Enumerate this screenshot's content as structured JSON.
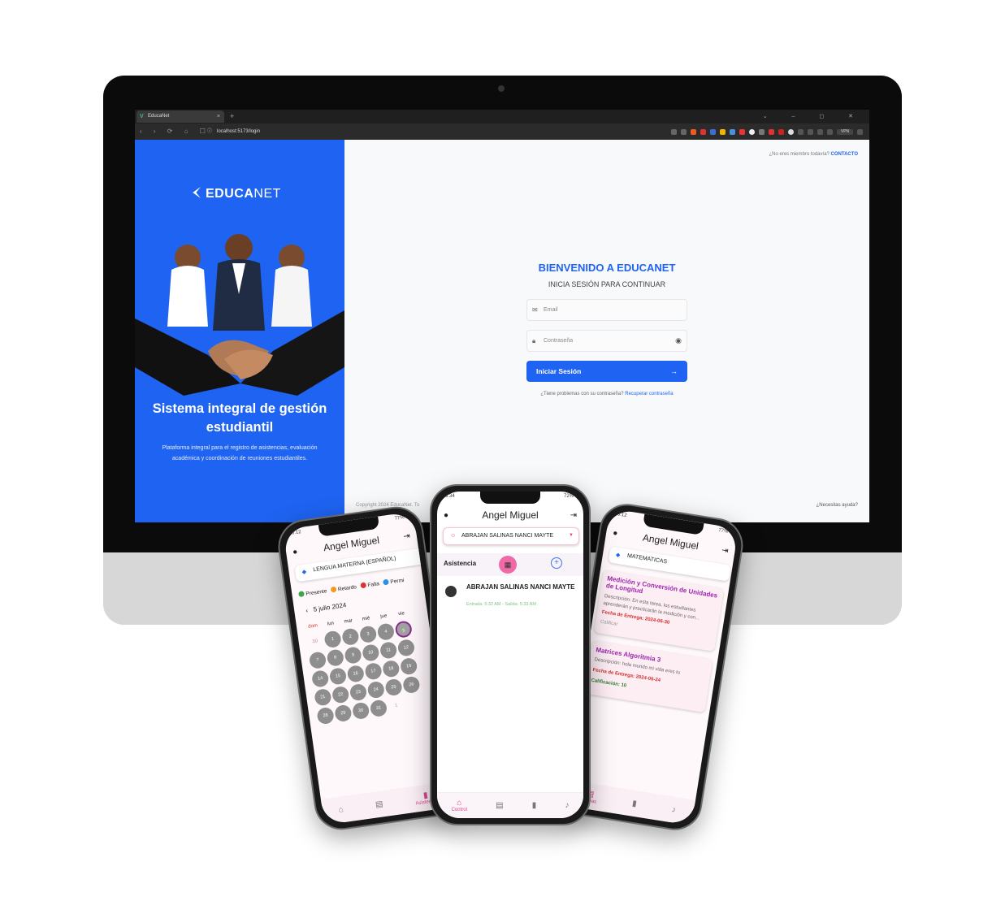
{
  "browser": {
    "tab_title": "EducaNet",
    "tab_close": "×",
    "new_tab": "+",
    "window_controls": "⌄ – ◻ ✕",
    "nav": "‹ › ⟳ ⌂ ☐",
    "url": "localhost:5173/login",
    "vpn": "VPN"
  },
  "hero": {
    "logo_bold": "EDUCA",
    "logo_light": "NET",
    "title": "Sistema integral de gestión estudiantil",
    "subtitle": "Plataforma integral para el registro de asistencias, evaluación académica y coordinación de reuniones estudiantiles."
  },
  "login": {
    "member_prompt": "¿No eres miembro todavía?",
    "member_link": "CONTACTO",
    "welcome": "BIENVENIDO A EDUCANET",
    "subtitle": "INICIA SESIÓN PARA CONTINUAR",
    "email_placeholder": "Email",
    "password_placeholder": "Contraseña",
    "submit": "Iniciar Sesión",
    "forgot_prompt": "¿Tiene problemas con su contraseña?",
    "forgot_link": "Recuperar contraseña",
    "copyright": "Copyright 2024 EducaNet. To",
    "help": "¿Necesitas ayuda?"
  },
  "phone_left": {
    "status": "6:12",
    "battery": "77%",
    "title": "Angel Miguel",
    "subject": "LENGUA MATERNA (ESPAÑOL)",
    "legend": [
      {
        "label": "Presente",
        "color": "#3aa646"
      },
      {
        "label": "Retardo",
        "color": "#f29a1d"
      },
      {
        "label": "Falta",
        "color": "#e03030"
      },
      {
        "label": "Permi",
        "color": "#2f8fe6"
      }
    ],
    "month": "5 julio 2024",
    "weekdays": [
      "dom",
      "lun",
      "mar",
      "mié",
      "jue",
      "vie"
    ],
    "weeks": [
      [
        "30",
        "1",
        "2",
        "3",
        "4",
        "5"
      ],
      [
        "7",
        "8",
        "9",
        "10",
        "11",
        "12"
      ],
      [
        "14",
        "15",
        "16",
        "17",
        "18",
        "19"
      ],
      [
        "21",
        "22",
        "23",
        "24",
        "25",
        "26"
      ],
      [
        "28",
        "29",
        "30",
        "31",
        "1",
        ""
      ]
    ],
    "nav_active": "Asistencia"
  },
  "phone_center": {
    "status": "5:34",
    "battery": "72%",
    "title": "Angel Miguel",
    "student": "ABRAJAN SALINAS NANCI MAYTE",
    "section": "Asistencia",
    "record_name": "ABRAJAN SALINAS NANCI MAYTE",
    "record_time": "Entrada: 5:32 AM - Salida: 5:33 AM",
    "nav_active": "Control"
  },
  "phone_right": {
    "status": "6:12",
    "battery": "77%",
    "title": "Angel Miguel",
    "subject": "MATEMATICAS",
    "tasks": [
      {
        "title": "Medición y Conversión de Unidades de Longitud",
        "desc": "Descripción: En esta tarea, los estudiantes aprenderán y practicarán la medición y con...",
        "due": "Fecha de Entrega: 2024-06-30",
        "status": "Calificar"
      },
      {
        "title": "Matrices Algoritmia 3",
        "desc": "Descripción: hola mundo mi vida eres tu",
        "due": "Fecha de Entrega: 2024-06-24",
        "grade": "Calificación: 10"
      }
    ],
    "nav_active": "Tareas"
  },
  "colors": {
    "brand_blue": "#1e63f1",
    "accent_pink": "#e0448e"
  }
}
